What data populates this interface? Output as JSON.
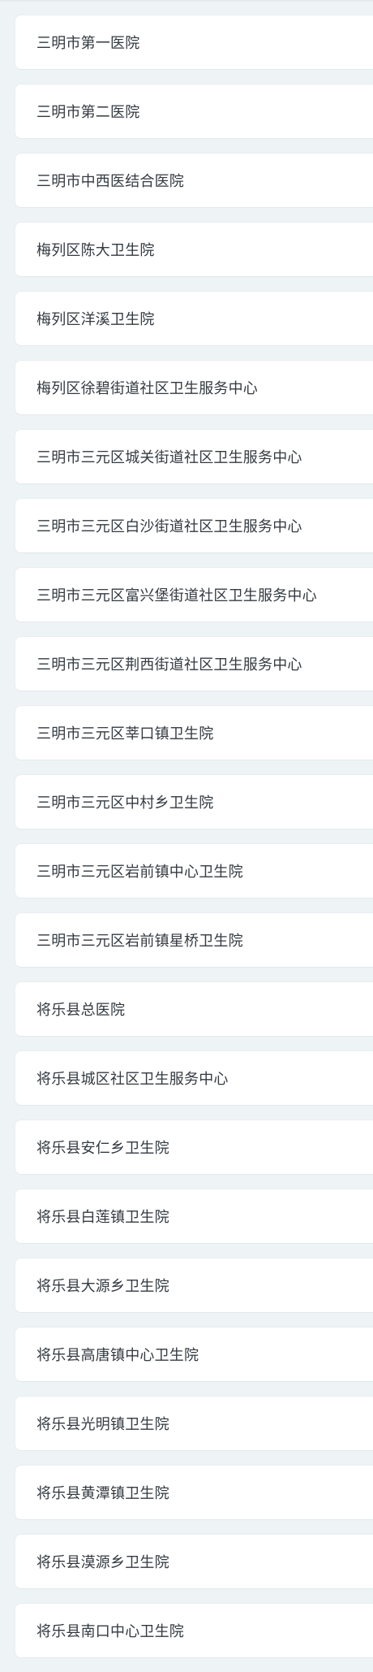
{
  "hospital_list": {
    "items": [
      "三明市第一医院",
      "三明市第二医院",
      "三明市中西医结合医院",
      "梅列区陈大卫生院",
      "梅列区洋溪卫生院",
      "梅列区徐碧街道社区卫生服务中心",
      "三明市三元区城关街道社区卫生服务中心",
      "三明市三元区白沙街道社区卫生服务中心",
      "三明市三元区富兴堡街道社区卫生服务中心",
      "三明市三元区荆西街道社区卫生服务中心",
      "三明市三元区莘口镇卫生院",
      "三明市三元区中村乡卫生院",
      "三明市三元区岩前镇中心卫生院",
      "三明市三元区岩前镇星桥卫生院",
      "将乐县总医院",
      "将乐县城区社区卫生服务中心",
      "将乐县安仁乡卫生院",
      "将乐县白莲镇卫生院",
      "将乐县大源乡卫生院",
      "将乐县高唐镇中心卫生院",
      "将乐县光明镇卫生院",
      "将乐县黄潭镇卫生院",
      "将乐县漠源乡卫生院",
      "将乐县南口中心卫生院"
    ]
  }
}
